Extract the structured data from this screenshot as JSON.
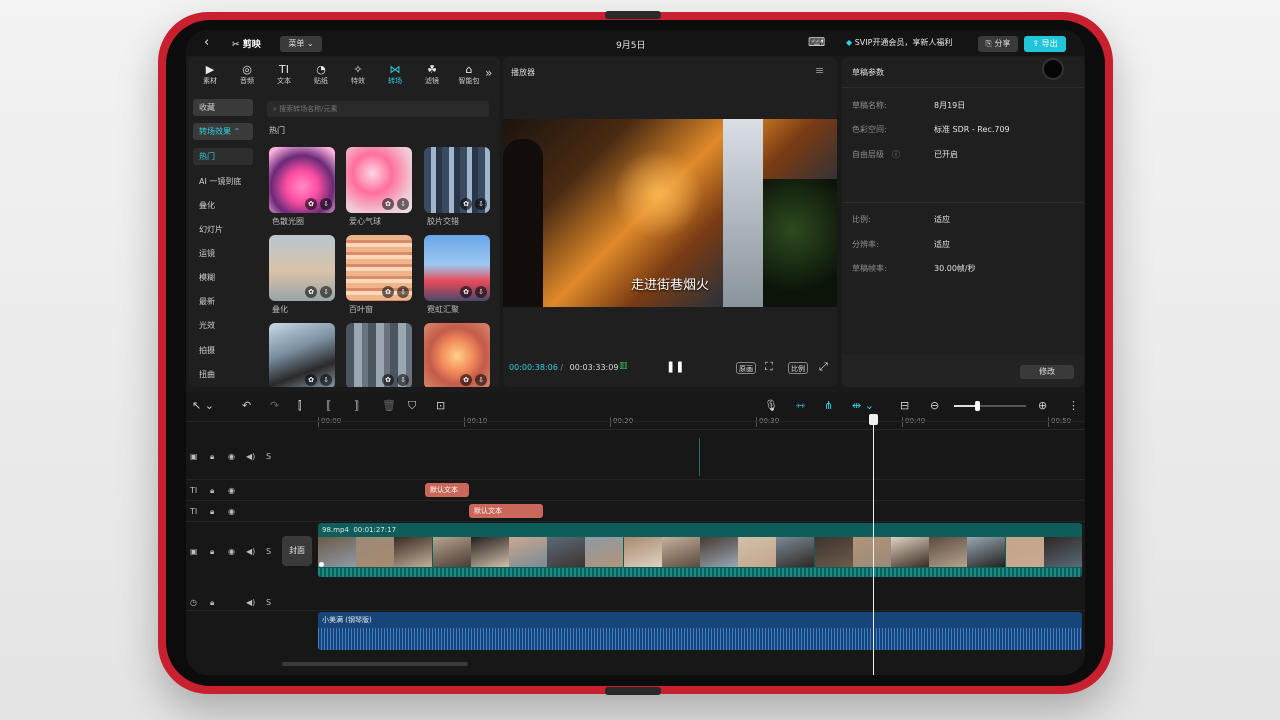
{
  "top": {
    "logo": "剪映",
    "menu": "菜单",
    "title": "9月5日",
    "vip": "SVIP开通会员，享新人福利",
    "share": "分享",
    "export": "导出"
  },
  "media_tabs": [
    {
      "icon": "media-icon",
      "glyph": "▶",
      "label": "素材"
    },
    {
      "icon": "audio-icon",
      "glyph": "◎",
      "label": "音频"
    },
    {
      "icon": "text-icon",
      "glyph": "TI",
      "label": "文本"
    },
    {
      "icon": "sticker-icon",
      "glyph": "◔",
      "label": "贴纸"
    },
    {
      "icon": "effects-icon",
      "glyph": "✧",
      "label": "特效"
    },
    {
      "icon": "transition-icon",
      "glyph": "⋈",
      "label": "转场"
    },
    {
      "icon": "filter-icon",
      "glyph": "☘",
      "label": "滤镜"
    },
    {
      "icon": "smart-icon",
      "glyph": "⌂",
      "label": "智能包"
    }
  ],
  "categories": [
    "收藏",
    "转场效果",
    "热门",
    "AI 一镜到底",
    "叠化",
    "幻灯片",
    "运镜",
    "模糊",
    "最新",
    "光效",
    "拍摄",
    "扭曲"
  ],
  "search_placeholder": "搜索转场名称/元素",
  "section_title": "热门",
  "thumbs": [
    {
      "label": "色散光圈"
    },
    {
      "label": "爱心气球"
    },
    {
      "label": "胶片交错"
    },
    {
      "label": "叠化"
    },
    {
      "label": "百叶窗"
    },
    {
      "label": "霓虹汇聚"
    },
    {
      "label": ""
    },
    {
      "label": ""
    },
    {
      "label": ""
    }
  ],
  "player": {
    "title": "播放器",
    "subtitle": "走进街巷烟火",
    "current_time": "00:00:38:06",
    "total_time": "00:03:33:09",
    "original": "原画",
    "ratio": "比例"
  },
  "props": {
    "title": "草稿参数",
    "rows": [
      {
        "label": "草稿名称:",
        "value": "8月19日"
      },
      {
        "label": "色彩空间:",
        "value": "标准 SDR - Rec.709"
      },
      {
        "label": "自由层级",
        "value": "已开启"
      },
      {
        "label": "比例:",
        "value": "适应"
      },
      {
        "label": "分辨率:",
        "value": "适应"
      },
      {
        "label": "草稿帧率:",
        "value": "30.00帧/秒"
      }
    ],
    "modify": "修改"
  },
  "ruler": [
    "00:00",
    "00:10",
    "00:20",
    "00:30",
    "00:40",
    "00:50"
  ],
  "tracks": {
    "text1": "默认文本",
    "text2": "默认文本",
    "cover": "封面",
    "video_name": "98.mp4",
    "video_duration": "00:01:27:17",
    "audio_name": "小美满 (钢琴版)",
    "s_label": "S"
  },
  "colors": {
    "accent": "#21c7d8",
    "device": "#c8202e"
  }
}
